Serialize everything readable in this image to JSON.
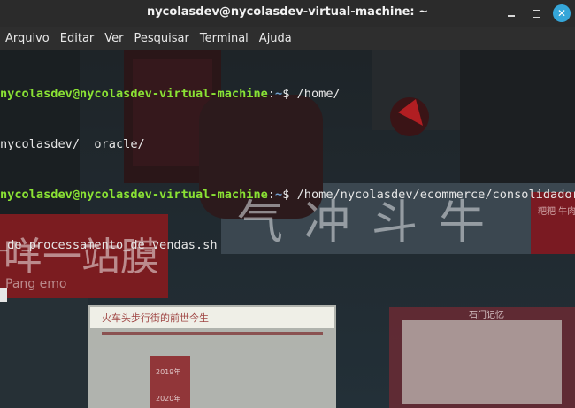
{
  "window": {
    "title": "nycolasdev@nycolasdev-virtual-machine: ~"
  },
  "menu": [
    "Arquivo",
    "Editar",
    "Ver",
    "Pesquisar",
    "Terminal",
    "Ajuda"
  ],
  "terminal": {
    "lines": [
      {
        "user": "nycolasdev@nycolasdev-virtual-machine",
        "sep": ":",
        "path": "~",
        "symbol": "$ ",
        "command": "/home/"
      },
      {
        "output": "nycolasdev/  oracle/"
      },
      {
        "user": "nycolasdev@nycolasdev-virtual-machine",
        "sep": ":",
        "path": "~",
        "symbol": "$ ",
        "command": "/home/nycolasdev/ecommerce/consolidador"
      },
      {
        "output": "_de_processamento_de_vendas.sh"
      }
    ]
  },
  "background_signs": {
    "big_sign": "气冲斗牛",
    "left_sign": "咩一站膜",
    "left_sign_sub": "Pang  emo",
    "right_tag": "粑粑 牛肉 火锅",
    "poster_left": "火车头步行街的前世今生",
    "poster_left_years": [
      "2019年",
      "2020年"
    ],
    "poster_right": "石门记忆"
  },
  "colors": {
    "prompt_user": "#8ae234",
    "prompt_path": "#729fcf",
    "text": "#e6e6e6",
    "close_button": "#35a6d9"
  }
}
